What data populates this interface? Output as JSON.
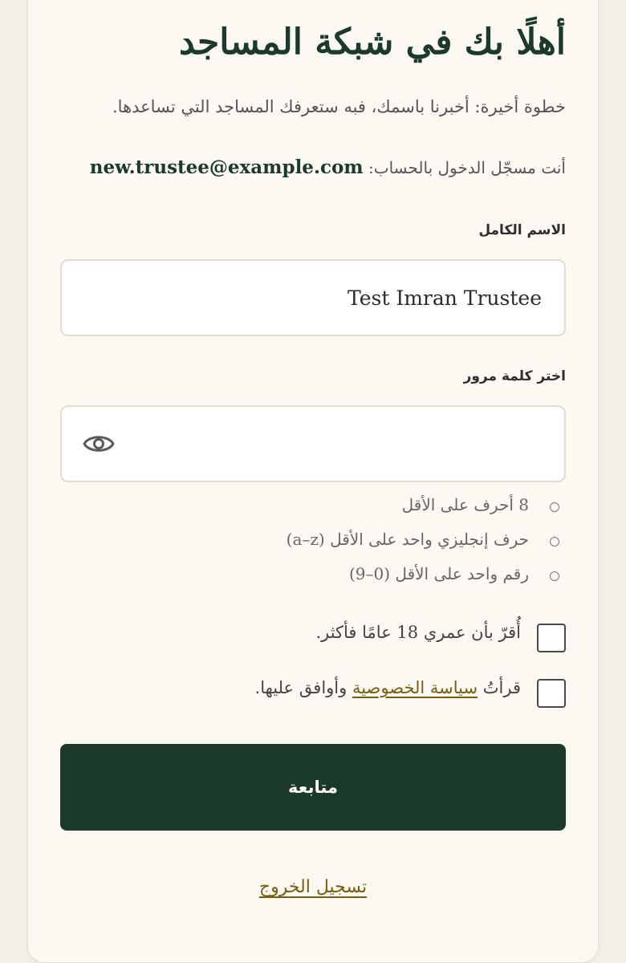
{
  "header": {
    "title": "أهلًا بك في شبكة المساجد",
    "subtitle": "خطوة أخيرة: أخبرنا باسمك، فبه ستعرفك المساجد التي تساعدها."
  },
  "account": {
    "signed_in_label": "أنت مسجّل الدخول بالحساب:",
    "email": "new.trustee@example.com"
  },
  "form": {
    "full_name_label": "الاسم الكامل",
    "full_name_value": "Test Imran Trustee",
    "password_label": "اختر كلمة مرور",
    "password_value": "",
    "password_toggle_icon": "eye-icon",
    "password_rules": [
      "8 أحرف على الأقل",
      "حرف إنجليزي واحد على الأقل  (a–z)",
      "رقم واحد على الأقل  (0–9)"
    ],
    "age_confirm": "أُقرّ بأن عمري 18 عامًا فأكثر.",
    "privacy_prefix": "قرأتُ ",
    "privacy_link": "سياسة الخصوصية",
    "privacy_suffix": " وأوافق عليها.",
    "age_checked": false,
    "privacy_checked": false
  },
  "actions": {
    "continue_label": "متابعة",
    "logout_label": "تسجيل الخروج"
  },
  "colors": {
    "brand_green": "#1c3a2a",
    "link_gold": "#7a5e0f",
    "background": "#fcf9f2"
  }
}
